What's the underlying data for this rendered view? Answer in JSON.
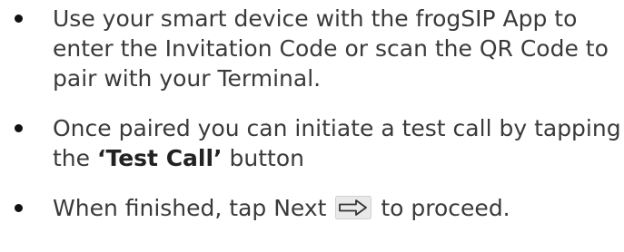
{
  "instructions": {
    "step1": {
      "text": "Use your smart device with the frogSIP App to enter the Invitation Code or scan the QR Code to pair with your Terminal."
    },
    "step2": {
      "text_before": "Once paired you can initiate a test call by tapping the ",
      "bold": "‘Test Call’",
      "text_after": " button"
    },
    "step3": {
      "text_before": "When finished, tap Next ",
      "icon": "next-arrow-icon",
      "text_after": " to proceed."
    }
  }
}
